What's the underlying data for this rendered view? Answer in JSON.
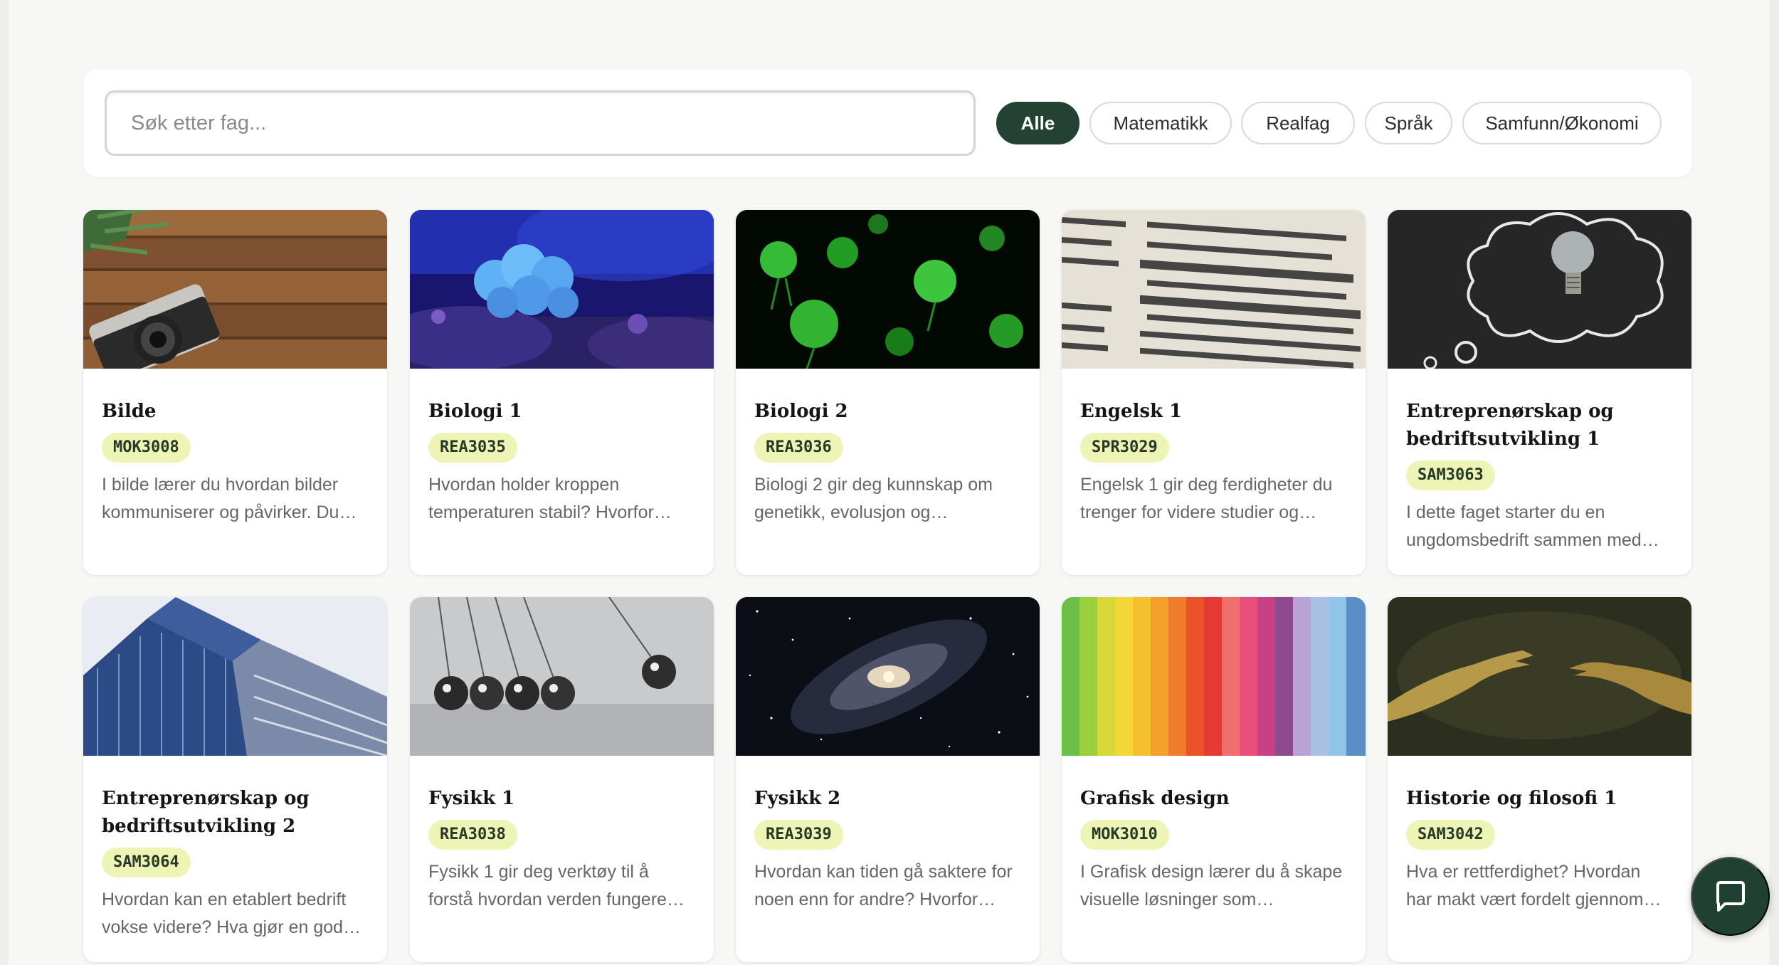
{
  "search": {
    "placeholder": "Søk etter fag..."
  },
  "filters": [
    {
      "label": "Alle",
      "active": true
    },
    {
      "label": "Matematikk",
      "active": false
    },
    {
      "label": "Realfag",
      "active": false
    },
    {
      "label": "Språk",
      "active": false
    },
    {
      "label": "Samfunn/Økonomi",
      "active": false
    }
  ],
  "courses": [
    {
      "title": "Bilde",
      "code": "MOK3008",
      "description": "I bilde lærer du hvordan bilder kommuniserer og påvirker. Du…",
      "image": "camera-on-wooden-table"
    },
    {
      "title": "Biologi 1",
      "code": "REA3035",
      "description": "Hvordan holder kroppen temperaturen stabil? Hvorfor…",
      "image": "blue-coral-reef"
    },
    {
      "title": "Biologi 2",
      "code": "REA3036",
      "description": "Biologi 2 gir deg kunnskap om genetikk, evolusjon og…",
      "image": "green-jellyfish"
    },
    {
      "title": "Engelsk 1",
      "code": "SPR3029",
      "description": "Engelsk 1 gir deg ferdigheter du trenger for videre studier og…",
      "image": "dictionary-page"
    },
    {
      "title": "Entreprenørskap og bedriftsutvikling 1",
      "code": "SAM3063",
      "description": "I dette faget starter du en ungdomsbedrift sammen med…",
      "image": "lightbulb-thought-bubble"
    },
    {
      "title": "Entreprenørskap og bedriftsutvikling 2",
      "code": "SAM3064",
      "description": "Hvordan kan en etablert bedrift vokse videre? Hva gjør en god…",
      "image": "glass-office-building"
    },
    {
      "title": "Fysikk 1",
      "code": "REA3038",
      "description": "Fysikk 1 gir deg verktøy til å forstå hvordan verden fungere…",
      "image": "newtons-cradle"
    },
    {
      "title": "Fysikk 2",
      "code": "REA3039",
      "description": "Hvordan kan tiden gå saktere for noen enn for andre? Hvorfor…",
      "image": "spiral-galaxy"
    },
    {
      "title": "Grafisk design",
      "code": "MOK3010",
      "description": "I Grafisk design lærer du å skape visuelle løsninger som…",
      "image": "rainbow-paper-strips"
    },
    {
      "title": "Historie og filosofi 1",
      "code": "SAM3042",
      "description": "Hva er rettferdighet? Hvordan har makt vært fordelt gjennom…",
      "image": "reaching-hands"
    }
  ],
  "chat": {
    "icon": "chat-bubble-icon"
  },
  "colors": {
    "accent": "#234233",
    "code_badge": "#eef3b6"
  }
}
